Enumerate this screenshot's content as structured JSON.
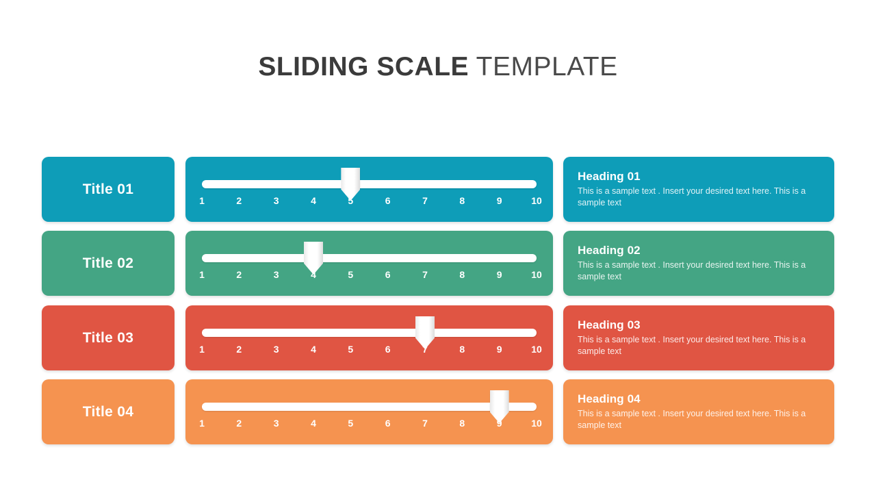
{
  "title": {
    "bold_part": "SLIDING SCALE",
    "light_part": " TEMPLATE"
  },
  "scale": {
    "min": 1,
    "max": 10,
    "ticks": [
      "1",
      "2",
      "3",
      "4",
      "5",
      "6",
      "7",
      "8",
      "9",
      "10"
    ]
  },
  "colors": {
    "row1": "#0e9db8",
    "row2": "#44a584",
    "row3": "#e05543",
    "row4": "#f59350",
    "title_text": "#3b3b3b",
    "marker": "#ffffff",
    "track": "#ffffff",
    "background": "#ffffff"
  },
  "rows": [
    {
      "title": "Title 01",
      "heading": "Heading 01",
      "body": "This is a sample text . Insert your desired text here. This is a sample text",
      "value": 5,
      "color": "#0e9db8"
    },
    {
      "title": "Title 02",
      "heading": "Heading 02",
      "body": "This is a sample text . Insert your desired text here. This is a sample text",
      "value": 4,
      "color": "#44a584"
    },
    {
      "title": "Title 03",
      "heading": "Heading 03",
      "body": "This is a sample text . Insert your desired text here. This is a sample text",
      "value": 7,
      "color": "#e05543"
    },
    {
      "title": "Title 04",
      "heading": "Heading 04",
      "body": "This is a sample text . Insert your desired text here. This is a sample text",
      "value": 9,
      "color": "#f59350"
    }
  ]
}
